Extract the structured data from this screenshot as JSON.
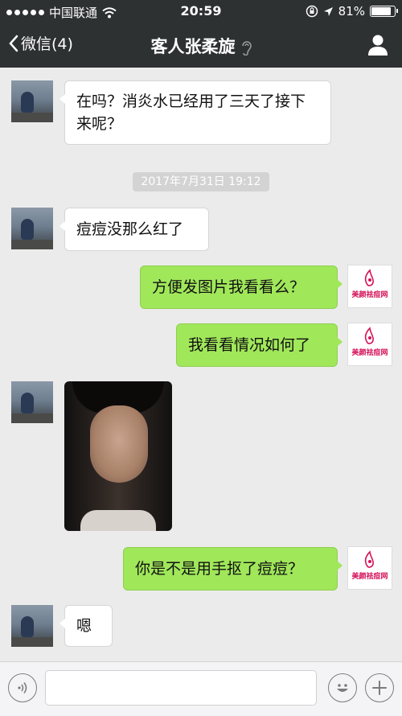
{
  "status_bar": {
    "carrier": "中国联通",
    "time": "20:59",
    "battery": "81%",
    "battery_level": 0.81
  },
  "nav": {
    "back_label": "微信(4)",
    "title": "客人张柔旋"
  },
  "messages": [
    {
      "side": "left",
      "type": "text",
      "text": "在吗？消炎水已经用了三天了接下来呢？"
    },
    {
      "type": "timestamp",
      "text": "2017年7月31日 19:12"
    },
    {
      "side": "left",
      "type": "text",
      "text": "痘痘没那么红了"
    },
    {
      "side": "right",
      "type": "text",
      "text": "方便发图片我看看么？"
    },
    {
      "side": "right",
      "type": "text",
      "text": "我看看情况如何了"
    },
    {
      "side": "left",
      "type": "image"
    },
    {
      "side": "right",
      "type": "text",
      "text": "你是不是用手抠了痘痘？"
    },
    {
      "side": "left",
      "type": "text",
      "text": "嗯"
    }
  ],
  "brand_logo": {
    "name": "美颜祛痘网",
    "color": "#d4145a"
  },
  "colors": {
    "header_bg": "#2e3132",
    "chat_bg": "#ebebeb",
    "bubble_sent": "#a0e75a",
    "bubble_received": "#ffffff"
  }
}
